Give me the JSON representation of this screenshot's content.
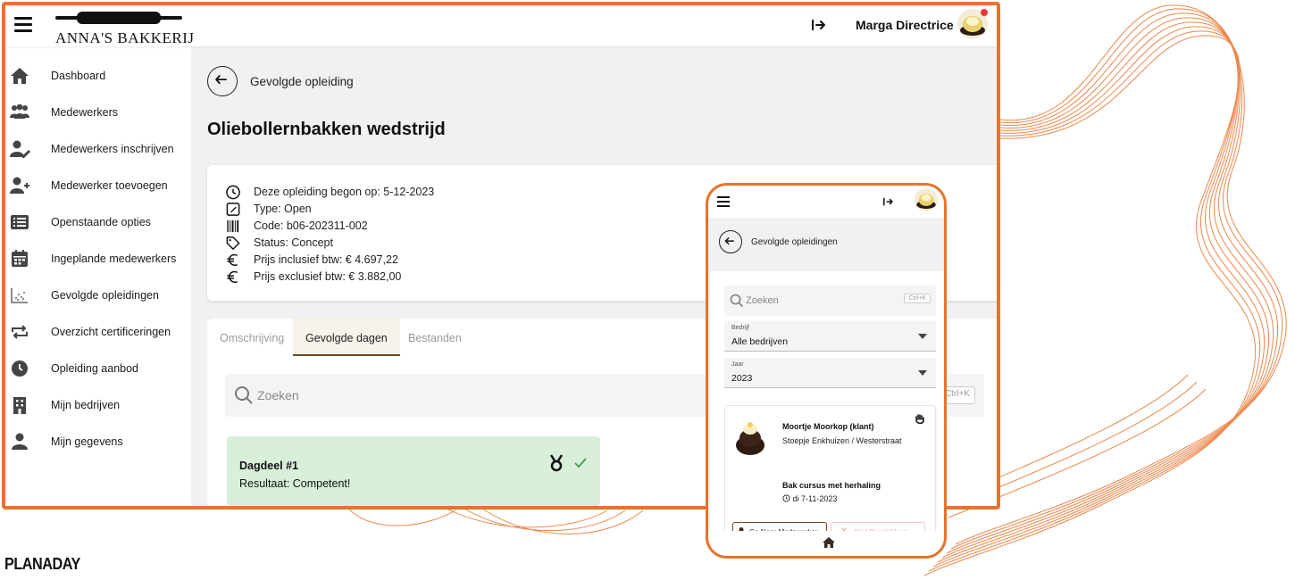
{
  "brand": {
    "name": "ANNA'S BAKKERIJ",
    "accent": "#e8732c",
    "footer_logo": "PLANADAY"
  },
  "header": {
    "user_name": "Marga Directrice"
  },
  "sidebar": {
    "items": [
      {
        "label": "Dashboard",
        "icon": "home-icon"
      },
      {
        "label": "Medewerkers",
        "icon": "users-icon"
      },
      {
        "label": "Medewerkers inschrijven",
        "icon": "user-edit-icon"
      },
      {
        "label": "Medewerker toevoegen",
        "icon": "user-plus-icon"
      },
      {
        "label": "Openstaande opties",
        "icon": "list-icon"
      },
      {
        "label": "Ingeplande medewerkers",
        "icon": "calendar-icon"
      },
      {
        "label": "Gevolgde opleidingen",
        "icon": "scatter-chart-icon"
      },
      {
        "label": "Overzicht certificeringen",
        "icon": "repeat-icon"
      },
      {
        "label": "Opleiding aanbod",
        "icon": "clock-icon"
      },
      {
        "label": "Mijn bedrijven",
        "icon": "building-icon"
      },
      {
        "label": "Mijn gegevens",
        "icon": "person-icon"
      }
    ]
  },
  "main": {
    "breadcrumb": "Gevolgde opleiding",
    "title": "Oliebollernbakken wedstrijd",
    "info": {
      "start": "Deze opleiding begon op: 5-12-2023",
      "type": "Type: Open",
      "code": "Code: b06-202311-002",
      "status": "Status: Concept",
      "price_incl": "Prijs inclusief btw: € 4.697,22",
      "price_excl": "Prijs exclusief btw: € 3.882,00"
    },
    "tabs": [
      {
        "label": "Omschrijving",
        "active": false
      },
      {
        "label": "Gevolgde dagen",
        "active": true
      },
      {
        "label": "Bestanden",
        "active": false
      }
    ],
    "search": {
      "placeholder": "Zoeken",
      "shortcut": "Ctrl+K"
    },
    "day": {
      "title": "Dagdeel #1",
      "result": "Resultaat: Competent!"
    }
  },
  "mobile": {
    "breadcrumb": "Gevolgde opleidingen",
    "search": {
      "placeholder": "Zoeken",
      "shortcut": "Ctrl+K"
    },
    "filter_company": {
      "label": "Bedrijf",
      "value": "Alle bedrijven"
    },
    "filter_year": {
      "label": "Jaar",
      "value": "2023"
    },
    "card": {
      "employee": "Moortje Moorkop (klant)",
      "location": "Stoepje Enkhuizen / Westerstraat",
      "course": "Bak cursus met herhaling",
      "date": "di 7-11-2023",
      "btn_go": "Ga Naar Medewerker",
      "btn_na": "Niet Beschikbaar"
    }
  }
}
